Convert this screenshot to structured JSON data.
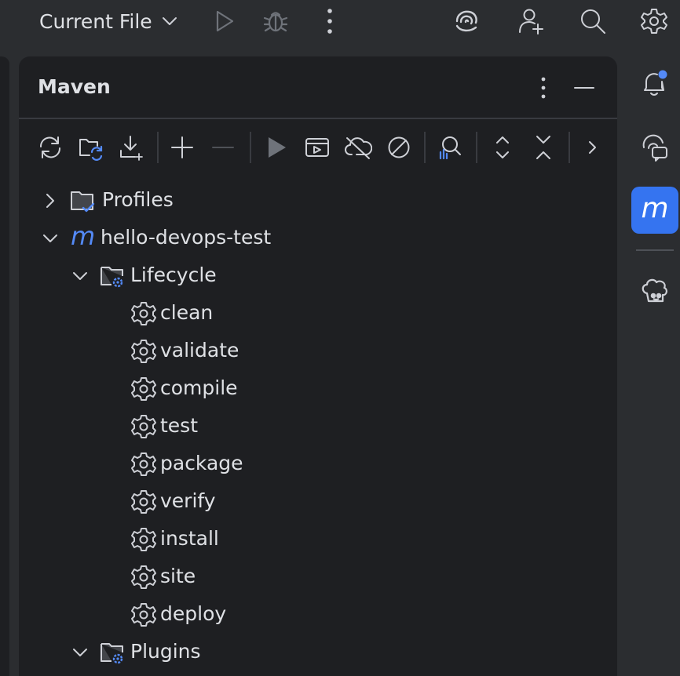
{
  "topbar": {
    "run_config_label": "Current File",
    "icons": [
      "chevron-down-icon",
      "run-icon",
      "debug-icon",
      "more-vertical-icon",
      "ai-assistant-icon",
      "add-user-icon",
      "search-icon",
      "gear-icon"
    ]
  },
  "maven": {
    "title": "Maven",
    "toolbar_icons": [
      "reload-all-icon",
      "reload-project-icon",
      "download-icon",
      "add-icon",
      "remove-icon",
      "run-icon",
      "run-config-icon",
      "offline-mode-icon",
      "skip-tests-icon",
      "analyze-dependencies-icon",
      "expand-all-icon",
      "collapse-all-icon",
      "more-arrow-icon"
    ],
    "tree": {
      "profiles_label": "Profiles",
      "project_label": "hello-devops-test",
      "lifecycle_label": "Lifecycle",
      "phases": [
        "clean",
        "validate",
        "compile",
        "test",
        "package",
        "verify",
        "install",
        "site",
        "deploy"
      ],
      "plugins_label": "Plugins"
    }
  },
  "colors": {
    "background": "#2b2d30",
    "panel": "#1e1f22",
    "text": "#dfe1e5",
    "accent": "#3574f0",
    "maven_blue": "#548af7",
    "disabled": "#6f737a"
  },
  "right_strip": {
    "icons": [
      "notifications-icon",
      "ai-chat-icon",
      "maven-icon",
      "cooking-hat-icon"
    ],
    "maven_letter": "m"
  }
}
